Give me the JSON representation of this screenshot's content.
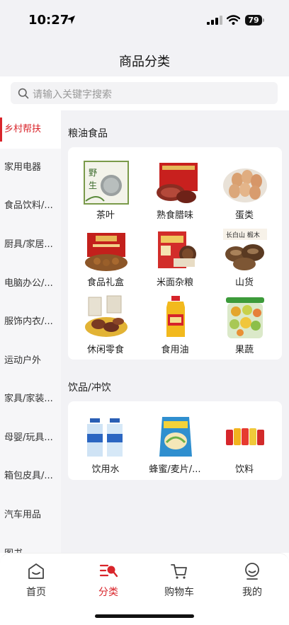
{
  "status_bar": {
    "time": "10:27",
    "battery": "79"
  },
  "nav": {
    "title": "商品分类"
  },
  "search": {
    "placeholder": "请输入关键字搜索"
  },
  "sidebar": {
    "items": [
      {
        "label": "乡村帮扶",
        "active": true
      },
      {
        "label": "家用电器"
      },
      {
        "label": "食品饮料/..."
      },
      {
        "label": "厨具/家居..."
      },
      {
        "label": "电脑办公/..."
      },
      {
        "label": "服饰内衣/..."
      },
      {
        "label": "运动户外"
      },
      {
        "label": "家具/家装..."
      },
      {
        "label": "母婴/玩具..."
      },
      {
        "label": "箱包皮具/..."
      },
      {
        "label": "汽车用品"
      },
      {
        "label": "图书"
      }
    ]
  },
  "sections": [
    {
      "title": "粮油食品",
      "items": [
        {
          "label": "茶叶",
          "icon": "tea-icon"
        },
        {
          "label": "熟食腊味",
          "icon": "cured-meat-icon"
        },
        {
          "label": "蛋类",
          "icon": "eggs-icon"
        },
        {
          "label": "食品礼盒",
          "icon": "gift-box-icon"
        },
        {
          "label": "米面杂粮",
          "icon": "grain-icon"
        },
        {
          "label": "山货",
          "icon": "mushroom-icon"
        },
        {
          "label": "休闲零食",
          "icon": "snack-icon"
        },
        {
          "label": "食用油",
          "icon": "oil-icon"
        },
        {
          "label": "果蔬",
          "icon": "fruit-icon"
        }
      ]
    },
    {
      "title": "饮品/冲饮",
      "items": [
        {
          "label": "饮用水",
          "icon": "water-icon"
        },
        {
          "label": "蜂蜜/麦片/...",
          "icon": "cereal-icon"
        },
        {
          "label": "饮料",
          "icon": "drinks-icon"
        }
      ]
    }
  ],
  "tabbar": {
    "home": "首页",
    "category": "分类",
    "cart": "购物车",
    "mine": "我的"
  },
  "colors": {
    "accent": "#d9252b",
    "background": "#f2f2f5"
  }
}
